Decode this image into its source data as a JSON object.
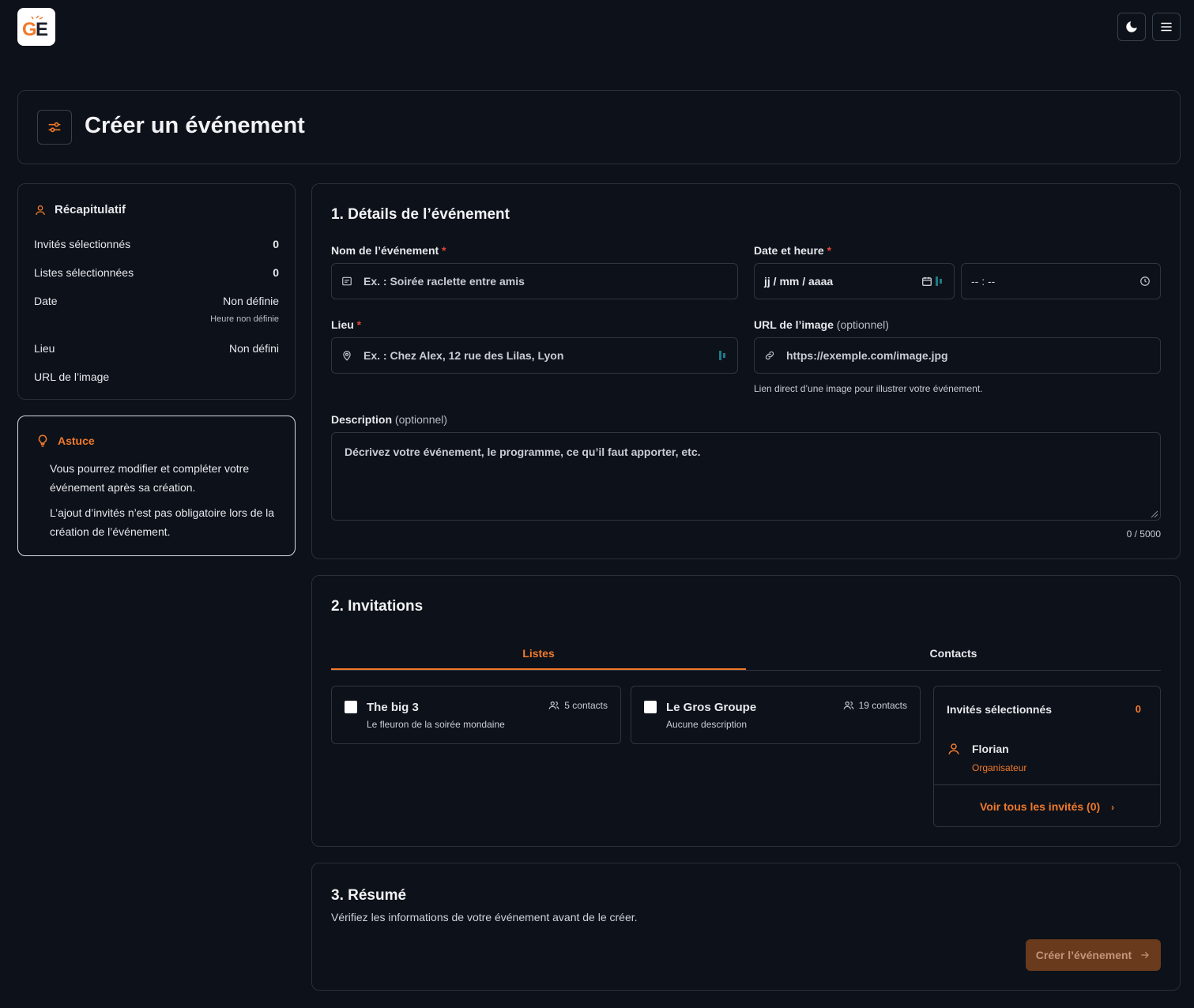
{
  "app": {
    "logo_text": "GE"
  },
  "topbar": {
    "theme_toggle_icon": "moon-icon",
    "menu_icon": "hamburger-icon"
  },
  "header": {
    "title": "Créer un événement",
    "icon": "sliders-icon"
  },
  "summary": {
    "title": "Récapitulatif",
    "rows": [
      {
        "label": "Invités sélectionnés",
        "value": "0"
      },
      {
        "label": "Listes sélectionnées",
        "value": "0"
      },
      {
        "label": "Date",
        "value": "Non définie",
        "sub": "Heure non définie"
      },
      {
        "label": "Lieu",
        "value": "Non défini"
      },
      {
        "label": "URL de l’image",
        "value": ""
      }
    ]
  },
  "tip": {
    "title": "Astuce",
    "paragraphs": [
      "Vous pourrez modifier et compléter votre événement après sa création.",
      "L’ajout d’invités n’est pas obligatoire lors de la création de l’événement."
    ]
  },
  "details": {
    "title": "1. Détails de l’événement",
    "name": {
      "label": "Nom de l’événement",
      "required": "*",
      "placeholder": "Ex. : Soirée raclette entre amis"
    },
    "datetime": {
      "label": "Date et heure",
      "required": "*",
      "date_placeholder": "jj / mm / aaaa",
      "time_placeholder": "-- : --"
    },
    "place": {
      "label": "Lieu",
      "required": "*",
      "placeholder": "Ex. : Chez Alex, 12 rue des Lilas, Lyon"
    },
    "image": {
      "label": "URL de l’image",
      "optional": "(optionnel)",
      "placeholder": "https://exemple.com/image.jpg",
      "hint": "Lien direct d’une image pour illustrer votre événement."
    },
    "description": {
      "label": "Description",
      "optional": "(optionnel)",
      "placeholder": "Décrivez votre événement, le programme, ce qu’il faut apporter, etc.",
      "counter": "0 / 5000"
    }
  },
  "invitations": {
    "title": "2. Invitations",
    "tabs": [
      "Listes",
      "Contacts"
    ],
    "lists": [
      {
        "name": "The big 3",
        "description": "Le fleuron de la soirée mondaine",
        "count": "5 contacts"
      },
      {
        "name": "Le Gros Groupe",
        "description": "Aucune description",
        "count": "19 contacts"
      }
    ],
    "selected": {
      "title": "Invités sélectionnés",
      "count": "0",
      "person_name": "Florian",
      "person_role": "Organisateur",
      "see_all": "Voir tous les invités (0)"
    }
  },
  "resume": {
    "title": "3. Résumé",
    "text": "Vérifiez les informations de votre événement avant de le créer.",
    "button": "Créer l’événement"
  },
  "colors": {
    "accent": "#f07a2c",
    "background": "#0d1119",
    "border": "#2a2f3a",
    "button_disabled": "#6a3a1d"
  }
}
